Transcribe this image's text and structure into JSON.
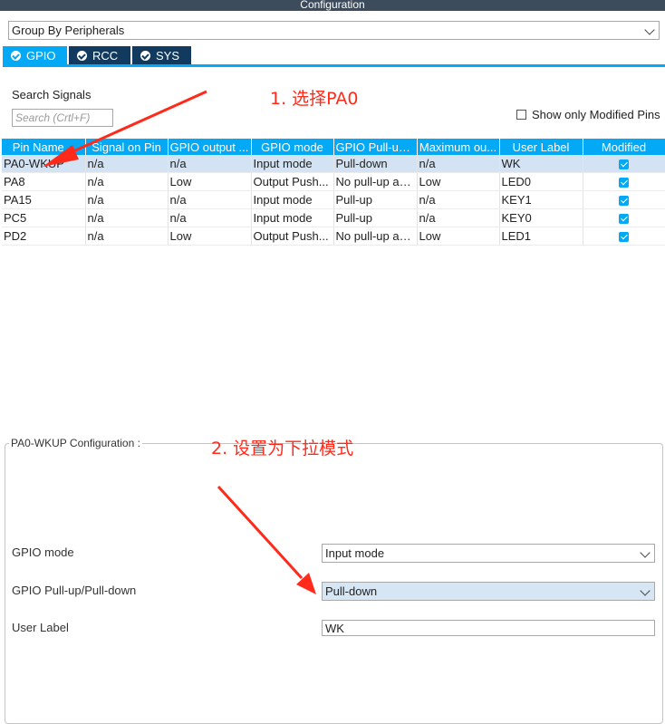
{
  "window": {
    "title": "Configuration"
  },
  "group_by": {
    "value": "Group By Peripherals"
  },
  "tabs": [
    {
      "label": "GPIO",
      "active": true
    },
    {
      "label": "RCC",
      "active": false
    },
    {
      "label": "SYS",
      "active": false
    }
  ],
  "search": {
    "label": "Search Signals",
    "placeholder": "Search (Crtl+F)"
  },
  "show_modified": {
    "label": "Show only Modified Pins",
    "checked": false
  },
  "table": {
    "columns": [
      "Pin Name",
      "Signal on Pin",
      "GPIO output ...",
      "GPIO mode",
      "GPIO Pull-up...",
      "Maximum ou...",
      "User Label",
      "Modified"
    ],
    "rows": [
      {
        "pin": "PA0-WKUP",
        "signal": "n/a",
        "output": "n/a",
        "mode": "Input mode",
        "pull": "Pull-down",
        "speed": "n/a",
        "label": "WK",
        "modified": true,
        "selected": true
      },
      {
        "pin": "PA8",
        "signal": "n/a",
        "output": "Low",
        "mode": "Output Push...",
        "pull": "No pull-up an...",
        "speed": "Low",
        "label": "LED0",
        "modified": true,
        "selected": false
      },
      {
        "pin": "PA15",
        "signal": "n/a",
        "output": "n/a",
        "mode": "Input mode",
        "pull": "Pull-up",
        "speed": "n/a",
        "label": "KEY1",
        "modified": true,
        "selected": false
      },
      {
        "pin": "PC5",
        "signal": "n/a",
        "output": "n/a",
        "mode": "Input mode",
        "pull": "Pull-up",
        "speed": "n/a",
        "label": "KEY0",
        "modified": true,
        "selected": false
      },
      {
        "pin": "PD2",
        "signal": "n/a",
        "output": "Low",
        "mode": "Output Push...",
        "pull": "No pull-up an...",
        "speed": "Low",
        "label": "LED1",
        "modified": true,
        "selected": false
      }
    ]
  },
  "config": {
    "title": "PA0-WKUP Configuration :",
    "fields": [
      {
        "label": "GPIO mode",
        "value": "Input mode"
      },
      {
        "label": "GPIO Pull-up/Pull-down",
        "value": "Pull-down"
      },
      {
        "label": "User Label",
        "value": "WK"
      }
    ]
  },
  "annotations": {
    "step1": "1. 选择PA0",
    "step2": "2. 设置为下拉模式"
  },
  "colors": {
    "accent": "#03a9f4",
    "tab_inactive": "#123a5f",
    "annotation": "#ff2a1a",
    "selected_row": "#d3e3f3"
  }
}
